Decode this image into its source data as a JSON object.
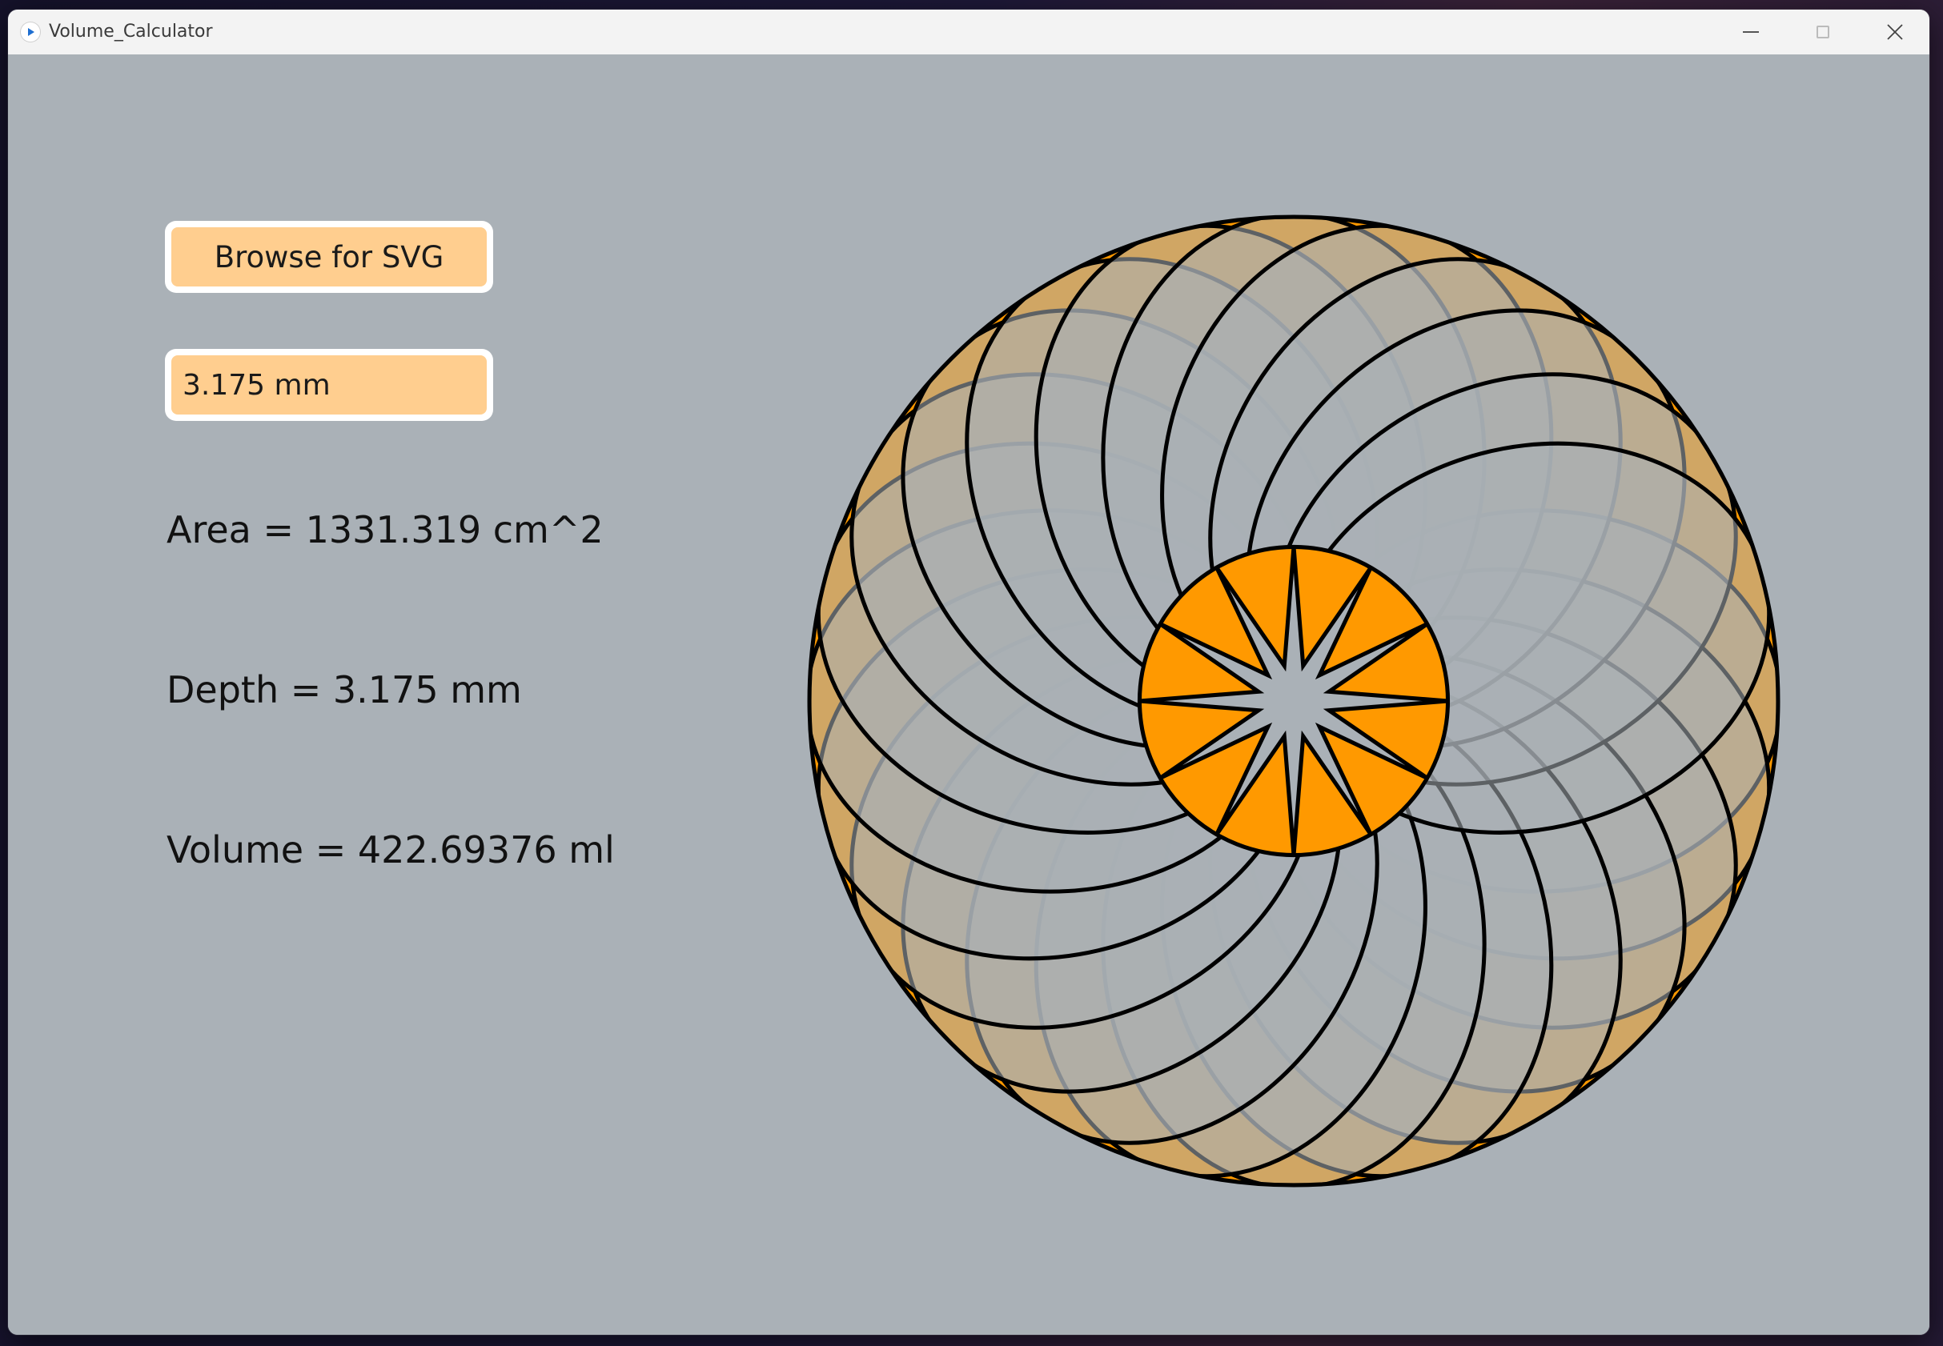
{
  "window": {
    "title": "Volume_Calculator",
    "background_color": "#aab1b7"
  },
  "controls": {
    "browse_button_label": "Browse for SVG",
    "depth_field_value": "3.175 mm",
    "control_fill_color": "#ffce8f"
  },
  "results": {
    "area_text": "Area = 1331.319 cm^2",
    "depth_text": "Depth = 3.175 mm",
    "volume_text": "Volume = 422.69376 ml"
  },
  "preview": {
    "fill_color": "#ff9900",
    "stroke_color": "#000000",
    "star_points": 12,
    "petal_count": 24
  }
}
